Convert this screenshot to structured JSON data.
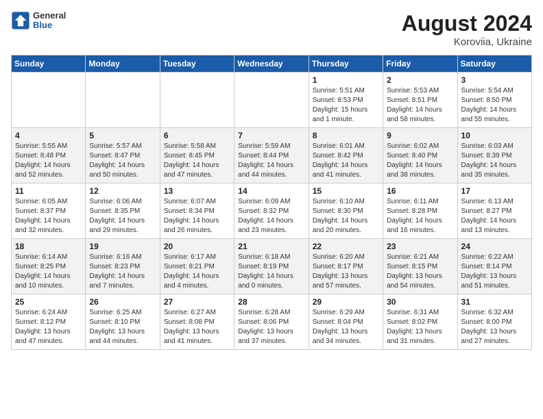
{
  "header": {
    "logo_general": "General",
    "logo_blue": "Blue",
    "title": "August 2024",
    "subtitle": "Koroviia, Ukraine"
  },
  "weekdays": [
    "Sunday",
    "Monday",
    "Tuesday",
    "Wednesday",
    "Thursday",
    "Friday",
    "Saturday"
  ],
  "weeks": [
    [
      {
        "day": "",
        "info": ""
      },
      {
        "day": "",
        "info": ""
      },
      {
        "day": "",
        "info": ""
      },
      {
        "day": "",
        "info": ""
      },
      {
        "day": "1",
        "info": "Sunrise: 5:51 AM\nSunset: 8:53 PM\nDaylight: 15 hours\nand 1 minute."
      },
      {
        "day": "2",
        "info": "Sunrise: 5:53 AM\nSunset: 8:51 PM\nDaylight: 14 hours\nand 58 minutes."
      },
      {
        "day": "3",
        "info": "Sunrise: 5:54 AM\nSunset: 8:50 PM\nDaylight: 14 hours\nand 55 minutes."
      }
    ],
    [
      {
        "day": "4",
        "info": "Sunrise: 5:55 AM\nSunset: 8:48 PM\nDaylight: 14 hours\nand 52 minutes."
      },
      {
        "day": "5",
        "info": "Sunrise: 5:57 AM\nSunset: 8:47 PM\nDaylight: 14 hours\nand 50 minutes."
      },
      {
        "day": "6",
        "info": "Sunrise: 5:58 AM\nSunset: 8:45 PM\nDaylight: 14 hours\nand 47 minutes."
      },
      {
        "day": "7",
        "info": "Sunrise: 5:59 AM\nSunset: 8:44 PM\nDaylight: 14 hours\nand 44 minutes."
      },
      {
        "day": "8",
        "info": "Sunrise: 6:01 AM\nSunset: 8:42 PM\nDaylight: 14 hours\nand 41 minutes."
      },
      {
        "day": "9",
        "info": "Sunrise: 6:02 AM\nSunset: 8:40 PM\nDaylight: 14 hours\nand 38 minutes."
      },
      {
        "day": "10",
        "info": "Sunrise: 6:03 AM\nSunset: 8:39 PM\nDaylight: 14 hours\nand 35 minutes."
      }
    ],
    [
      {
        "day": "11",
        "info": "Sunrise: 6:05 AM\nSunset: 8:37 PM\nDaylight: 14 hours\nand 32 minutes."
      },
      {
        "day": "12",
        "info": "Sunrise: 6:06 AM\nSunset: 8:35 PM\nDaylight: 14 hours\nand 29 minutes."
      },
      {
        "day": "13",
        "info": "Sunrise: 6:07 AM\nSunset: 8:34 PM\nDaylight: 14 hours\nand 26 minutes."
      },
      {
        "day": "14",
        "info": "Sunrise: 6:09 AM\nSunset: 8:32 PM\nDaylight: 14 hours\nand 23 minutes."
      },
      {
        "day": "15",
        "info": "Sunrise: 6:10 AM\nSunset: 8:30 PM\nDaylight: 14 hours\nand 20 minutes."
      },
      {
        "day": "16",
        "info": "Sunrise: 6:11 AM\nSunset: 8:28 PM\nDaylight: 14 hours\nand 16 minutes."
      },
      {
        "day": "17",
        "info": "Sunrise: 6:13 AM\nSunset: 8:27 PM\nDaylight: 14 hours\nand 13 minutes."
      }
    ],
    [
      {
        "day": "18",
        "info": "Sunrise: 6:14 AM\nSunset: 8:25 PM\nDaylight: 14 hours\nand 10 minutes."
      },
      {
        "day": "19",
        "info": "Sunrise: 6:16 AM\nSunset: 8:23 PM\nDaylight: 14 hours\nand 7 minutes."
      },
      {
        "day": "20",
        "info": "Sunrise: 6:17 AM\nSunset: 8:21 PM\nDaylight: 14 hours\nand 4 minutes."
      },
      {
        "day": "21",
        "info": "Sunrise: 6:18 AM\nSunset: 8:19 PM\nDaylight: 14 hours\nand 0 minutes."
      },
      {
        "day": "22",
        "info": "Sunrise: 6:20 AM\nSunset: 8:17 PM\nDaylight: 13 hours\nand 57 minutes."
      },
      {
        "day": "23",
        "info": "Sunrise: 6:21 AM\nSunset: 8:15 PM\nDaylight: 13 hours\nand 54 minutes."
      },
      {
        "day": "24",
        "info": "Sunrise: 6:22 AM\nSunset: 8:14 PM\nDaylight: 13 hours\nand 51 minutes."
      }
    ],
    [
      {
        "day": "25",
        "info": "Sunrise: 6:24 AM\nSunset: 8:12 PM\nDaylight: 13 hours\nand 47 minutes."
      },
      {
        "day": "26",
        "info": "Sunrise: 6:25 AM\nSunset: 8:10 PM\nDaylight: 13 hours\nand 44 minutes."
      },
      {
        "day": "27",
        "info": "Sunrise: 6:27 AM\nSunset: 8:08 PM\nDaylight: 13 hours\nand 41 minutes."
      },
      {
        "day": "28",
        "info": "Sunrise: 6:28 AM\nSunset: 8:06 PM\nDaylight: 13 hours\nand 37 minutes."
      },
      {
        "day": "29",
        "info": "Sunrise: 6:29 AM\nSunset: 8:04 PM\nDaylight: 13 hours\nand 34 minutes."
      },
      {
        "day": "30",
        "info": "Sunrise: 6:31 AM\nSunset: 8:02 PM\nDaylight: 13 hours\nand 31 minutes."
      },
      {
        "day": "31",
        "info": "Sunrise: 6:32 AM\nSunset: 8:00 PM\nDaylight: 13 hours\nand 27 minutes."
      }
    ]
  ]
}
